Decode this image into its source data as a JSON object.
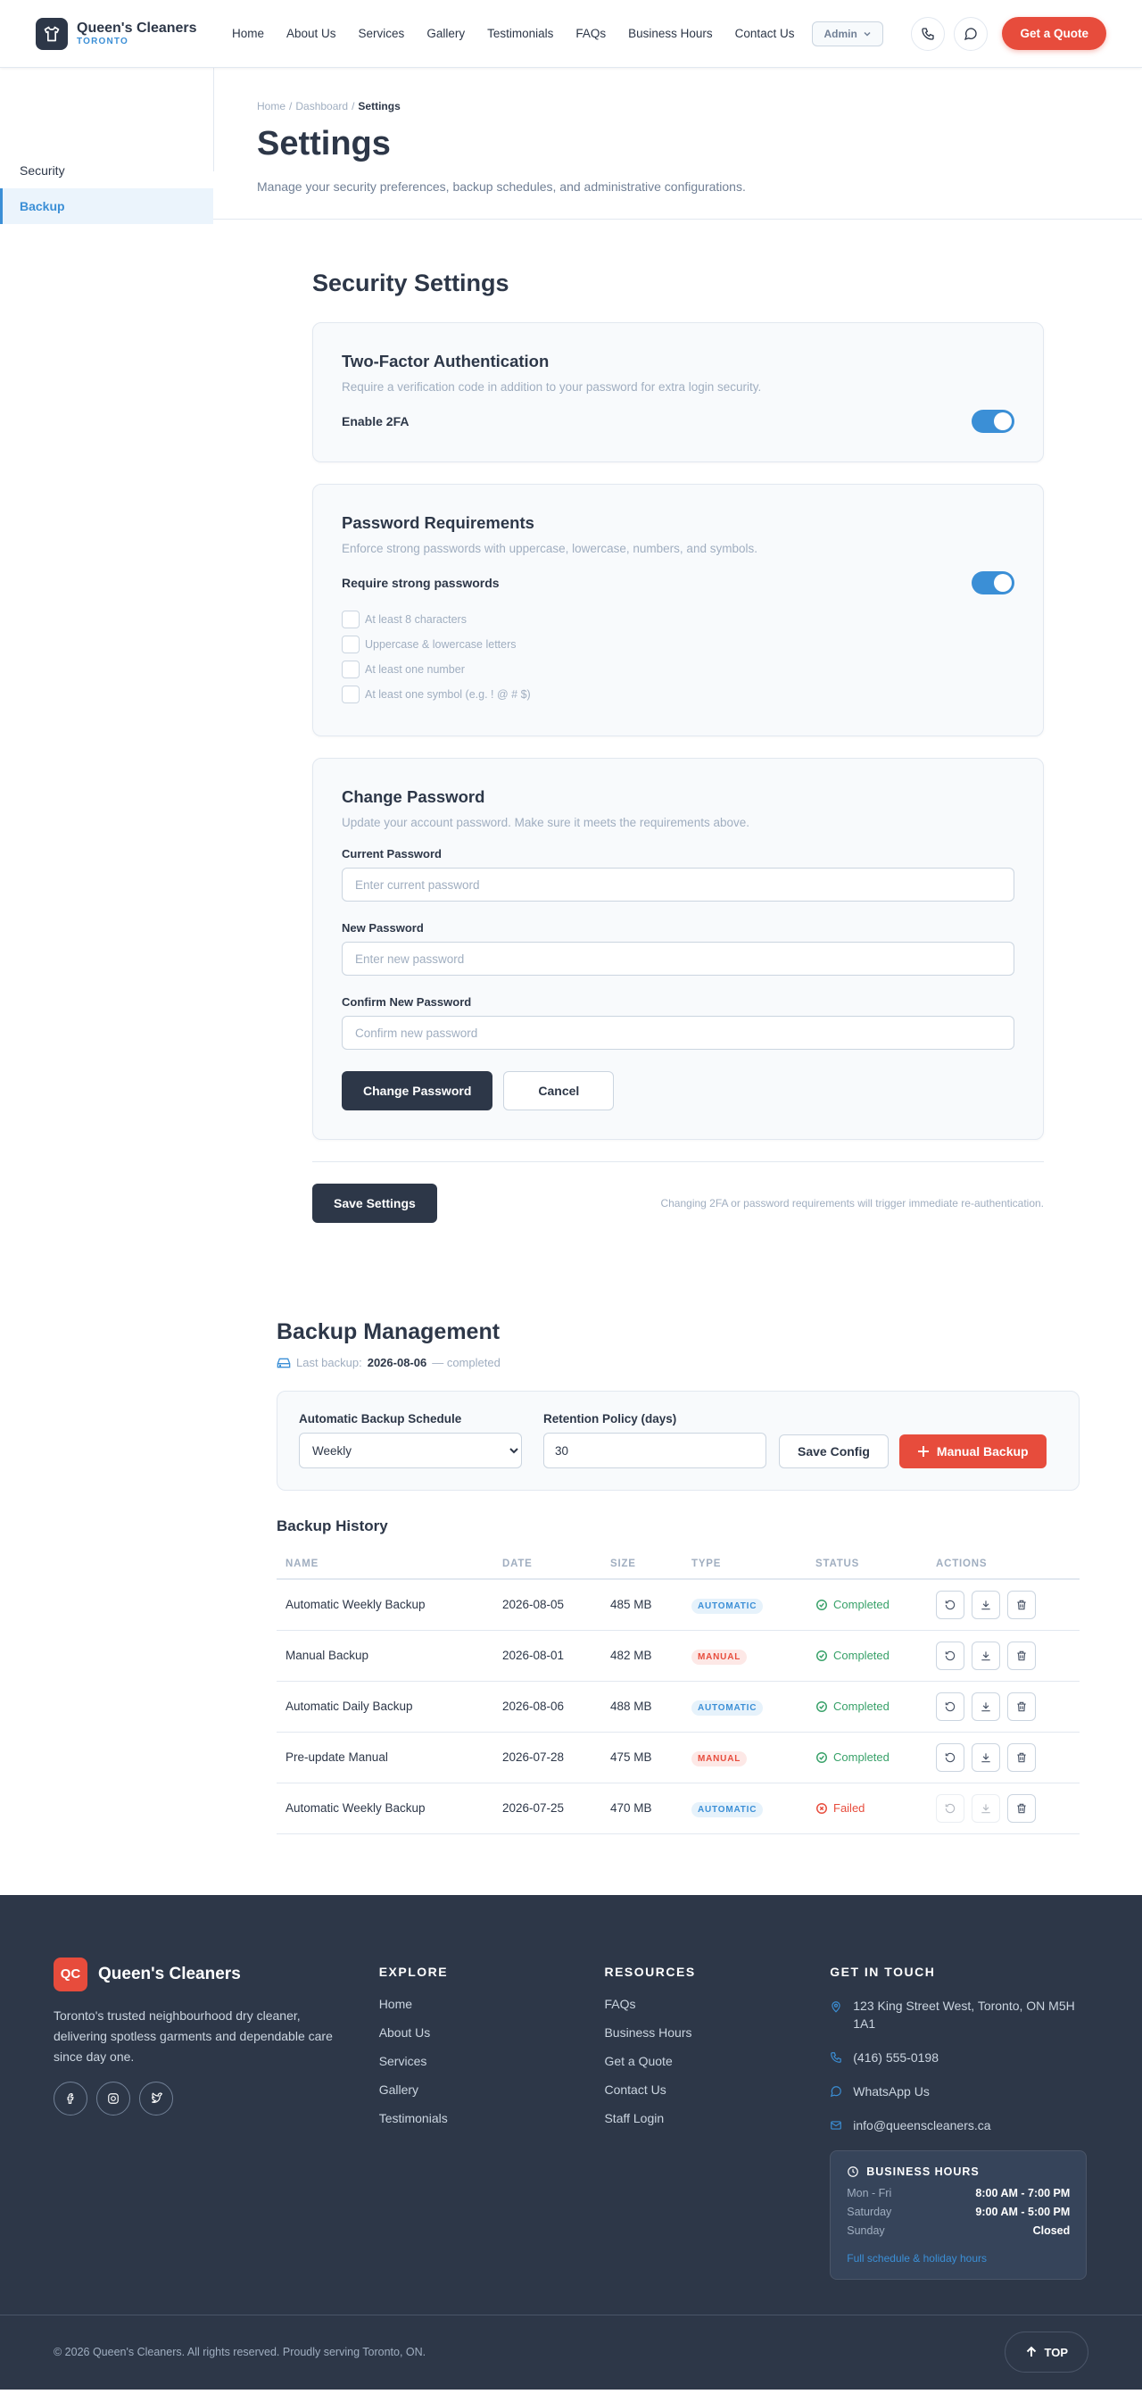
{
  "header": {
    "brand_name": "Queen's Cleaners",
    "brand_sub": "TORONTO",
    "nav": [
      "Home",
      "About Us",
      "Services",
      "Gallery",
      "Testimonials",
      "FAQs",
      "Business Hours",
      "Contact Us"
    ],
    "admin_label": "Admin",
    "quote_label": "Get a Quote"
  },
  "sidebar": {
    "items": [
      {
        "label": "Security"
      },
      {
        "label": "Backup"
      }
    ]
  },
  "page": {
    "breadcrumb": [
      "Home",
      "Dashboard",
      "Settings"
    ],
    "title": "Settings",
    "subtitle": "Manage your security preferences, backup schedules, and administrative configurations."
  },
  "security": {
    "title": "Security Settings",
    "twofa": {
      "title": "Two-Factor Authentication",
      "desc": "Require a verification code in addition to your password for extra login security.",
      "toggle_label": "Enable 2FA",
      "enabled": true
    },
    "password_req": {
      "title": "Password Requirements",
      "desc": "Enforce strong passwords with uppercase, lowercase, numbers, and symbols.",
      "toggle_label": "Require strong passwords",
      "enabled": true,
      "items": [
        "At least 8 characters",
        "Uppercase & lowercase letters",
        "At least one number",
        "At least one symbol (e.g. ! @ # $)"
      ]
    },
    "change_password": {
      "title": "Change Password",
      "desc": "Update your account password. Make sure it meets the requirements above.",
      "current_label": "Current Password",
      "current_placeholder": "Enter current password",
      "new_label": "New Password",
      "new_placeholder": "Enter new password",
      "confirm_label": "Confirm New Password",
      "confirm_placeholder": "Confirm new password",
      "submit_label": "Change Password",
      "cancel_label": "Cancel"
    },
    "save_label": "Save Settings",
    "save_note": "Changing 2FA or password requirements will trigger immediate re-authentication."
  },
  "backup": {
    "title": "Backup Management",
    "last_prefix": "Last backup:",
    "last_date": "2026-08-06",
    "last_suffix": "— completed",
    "schedule_label": "Automatic Backup Schedule",
    "schedule_value": "Weekly",
    "retention_label": "Retention Policy (days)",
    "retention_value": "30",
    "save_config_label": "Save Config",
    "manual_label": "Manual Backup",
    "history_title": "Backup History",
    "columns": [
      "NAME",
      "DATE",
      "SIZE",
      "TYPE",
      "STATUS",
      "ACTIONS"
    ],
    "rows": [
      {
        "name": "Automatic Weekly Backup",
        "date": "2026-08-05",
        "size": "485 MB",
        "type": "AUTOMATIC",
        "status": "Completed"
      },
      {
        "name": "Manual Backup",
        "date": "2026-08-01",
        "size": "482 MB",
        "type": "MANUAL",
        "status": "Completed"
      },
      {
        "name": "Automatic Daily Backup",
        "date": "2026-08-06",
        "size": "488 MB",
        "type": "AUTOMATIC",
        "status": "Completed"
      },
      {
        "name": "Pre-update Manual",
        "date": "2026-07-28",
        "size": "475 MB",
        "type": "MANUAL",
        "status": "Completed"
      },
      {
        "name": "Automatic Weekly Backup",
        "date": "2026-07-25",
        "size": "470 MB",
        "type": "AUTOMATIC",
        "status": "Failed"
      }
    ]
  },
  "footer": {
    "logo_text": "QC",
    "brand_name": "Queen's Cleaners",
    "tagline": "Toronto's trusted neighbourhood dry cleaner, delivering spotless garments and dependable care since day one.",
    "explore_title": "EXPLORE",
    "explore": [
      "Home",
      "About Us",
      "Services",
      "Gallery",
      "Testimonials"
    ],
    "resources_title": "RESOURCES",
    "resources": [
      "FAQs",
      "Business Hours",
      "Get a Quote",
      "Contact Us",
      "Staff Login"
    ],
    "contact_title": "GET IN TOUCH",
    "address": "123 King Street West, Toronto, ON M5H 1A1",
    "phone": "(416) 555-0198",
    "whatsapp": "WhatsApp Us",
    "email": "info@queenscleaners.ca",
    "hours_title": "BUSINESS HOURS",
    "hours": [
      {
        "day": "Mon - Fri",
        "time": "8:00 AM - 7:00 PM"
      },
      {
        "day": "Saturday",
        "time": "9:00 AM - 5:00 PM"
      },
      {
        "day": "Sunday",
        "time": "Closed"
      }
    ],
    "hours_link": "Full schedule & holiday hours",
    "copyright": "© 2026 Queen's Cleaners. All rights reserved. Proudly serving Toronto, ON.",
    "top_label": "TOP"
  },
  "colors": {
    "accent": "#e74c3c",
    "primary": "#3b8fd6",
    "dark": "#2d3748",
    "success": "#38a169"
  }
}
